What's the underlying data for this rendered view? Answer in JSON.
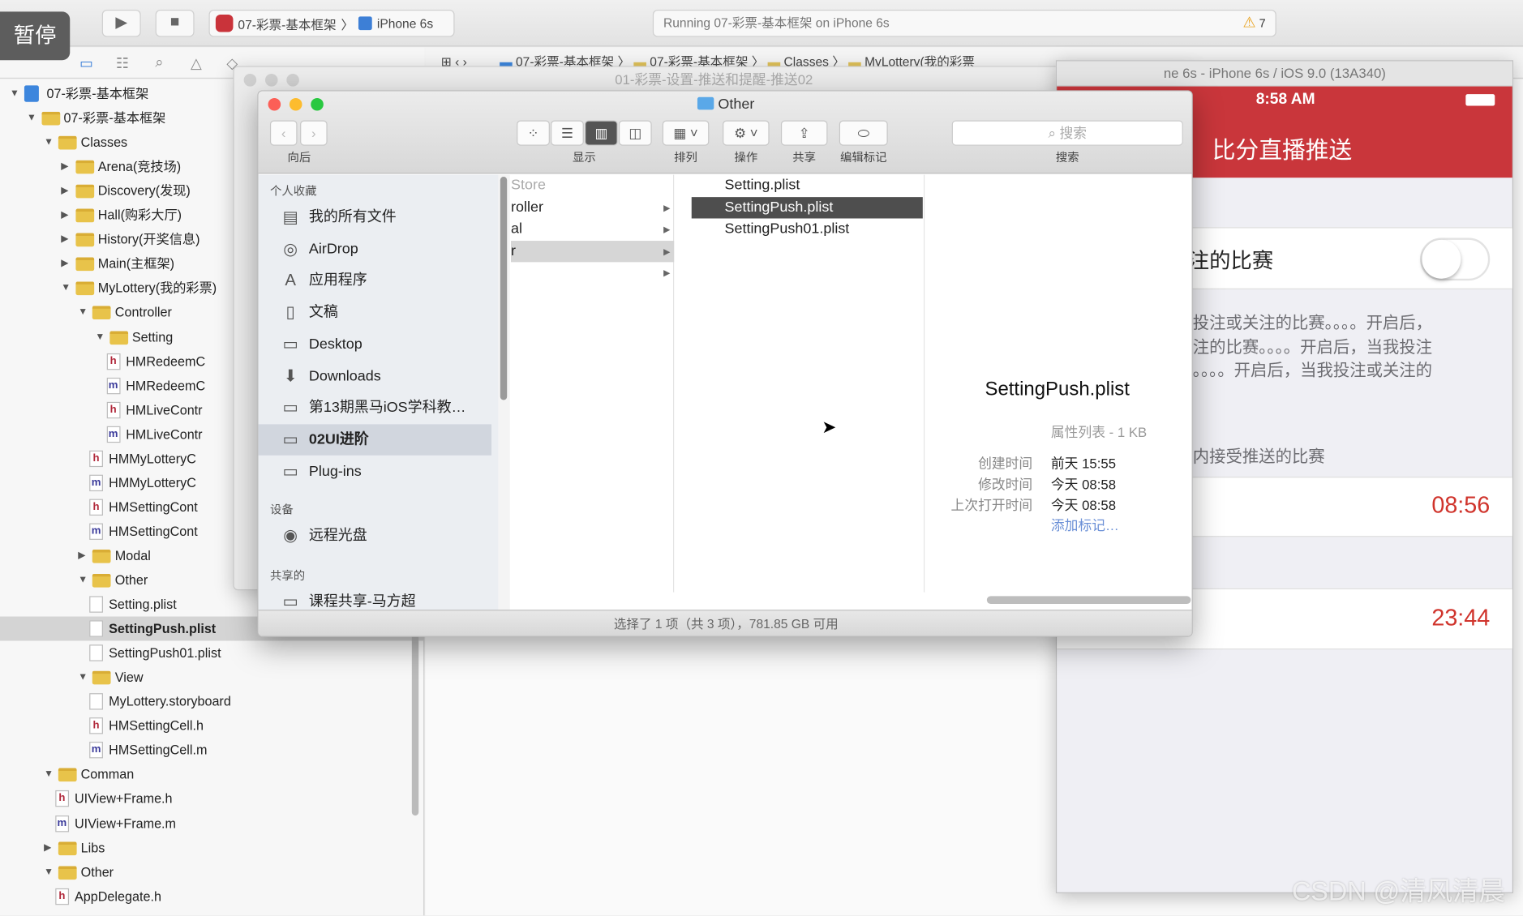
{
  "overlay": {
    "pause_label": "暂停"
  },
  "toolbar": {
    "scheme_app": "07-彩票-基本框架",
    "scheme_device": "iPhone 6s",
    "status": "Running 07-彩票-基本框架 on iPhone 6s",
    "warning_count": "7"
  },
  "jumpbar": {
    "path": [
      "07-彩票-基本框架",
      "07-彩票-基本框架",
      "Classes",
      "MyLottery(我的彩票"
    ]
  },
  "navigator": {
    "items": [
      {
        "label": "07-彩票-基本框架",
        "level": 0,
        "kind": "project",
        "open": true
      },
      {
        "label": "07-彩票-基本框架",
        "level": 1,
        "kind": "folder",
        "open": true
      },
      {
        "label": "Classes",
        "level": 2,
        "kind": "folder",
        "open": true
      },
      {
        "label": "Arena(竞技场)",
        "level": 3,
        "kind": "folder",
        "open": false
      },
      {
        "label": "Discovery(发现)",
        "level": 3,
        "kind": "folder",
        "open": false
      },
      {
        "label": "Hall(购彩大厅)",
        "level": 3,
        "kind": "folder",
        "open": false
      },
      {
        "label": "History(开奖信息)",
        "level": 3,
        "kind": "folder",
        "open": false
      },
      {
        "label": "Main(主框架)",
        "level": 3,
        "kind": "folder",
        "open": false
      },
      {
        "label": "MyLottery(我的彩票)",
        "level": 3,
        "kind": "folder",
        "open": true
      },
      {
        "label": "Controller",
        "level": 4,
        "kind": "folder",
        "open": true
      },
      {
        "label": "Setting",
        "level": 5,
        "kind": "folder",
        "open": true
      },
      {
        "label": "HMRedeemC",
        "level": 6,
        "kind": "h"
      },
      {
        "label": "HMRedeemC",
        "level": 6,
        "kind": "m"
      },
      {
        "label": "HMLiveContr",
        "level": 6,
        "kind": "h"
      },
      {
        "label": "HMLiveContr",
        "level": 6,
        "kind": "m"
      },
      {
        "label": "HMMyLotteryC",
        "level": 5,
        "kind": "h"
      },
      {
        "label": "HMMyLotteryC",
        "level": 5,
        "kind": "m"
      },
      {
        "label": "HMSettingCont",
        "level": 5,
        "kind": "h"
      },
      {
        "label": "HMSettingCont",
        "level": 5,
        "kind": "m"
      },
      {
        "label": "Modal",
        "level": 4,
        "kind": "folder",
        "open": false
      },
      {
        "label": "Other",
        "level": 4,
        "kind": "folder",
        "open": true
      },
      {
        "label": "Setting.plist",
        "level": 5,
        "kind": "plist"
      },
      {
        "label": "SettingPush.plist",
        "level": 5,
        "kind": "plist",
        "selected": true
      },
      {
        "label": "SettingPush01.plist",
        "level": 5,
        "kind": "plist"
      },
      {
        "label": "View",
        "level": 4,
        "kind": "folder",
        "open": true
      },
      {
        "label": "MyLottery.storyboard",
        "level": 5,
        "kind": "plist"
      },
      {
        "label": "HMSettingCell.h",
        "level": 5,
        "kind": "h"
      },
      {
        "label": "HMSettingCell.m",
        "level": 5,
        "kind": "m"
      },
      {
        "label": "Comman",
        "level": 2,
        "kind": "folder",
        "open": true
      },
      {
        "label": "UIView+Frame.h",
        "level": 3,
        "kind": "h"
      },
      {
        "label": "UIView+Frame.m",
        "level": 3,
        "kind": "m"
      },
      {
        "label": "Libs",
        "level": 2,
        "kind": "folder",
        "open": false
      },
      {
        "label": "Other",
        "level": 2,
        "kind": "folder",
        "open": true
      },
      {
        "label": "AppDelegate.h",
        "level": 3,
        "kind": "h"
      }
    ]
  },
  "back_window": {
    "title": "01-彩票-设置-推送和提醒-推送02"
  },
  "finder": {
    "title": "Other",
    "toolbar": {
      "back_forward": "向后",
      "view": "显示",
      "arrange": "排列",
      "action": "操作",
      "share": "共享",
      "tags": "编辑标记",
      "search_label": "搜索",
      "search_placeholder": "搜索"
    },
    "sidebar": {
      "favorites_header": "个人收藏",
      "favorites": [
        {
          "label": "我的所有文件",
          "icon": "all-files-icon"
        },
        {
          "label": "AirDrop",
          "icon": "airdrop-icon"
        },
        {
          "label": "应用程序",
          "icon": "applications-icon"
        },
        {
          "label": "文稿",
          "icon": "documents-icon"
        },
        {
          "label": "Desktop",
          "icon": "desktop-icon"
        },
        {
          "label": "Downloads",
          "icon": "downloads-icon"
        },
        {
          "label": "第13期黑马iOS学科教…",
          "icon": "folder-icon"
        },
        {
          "label": "02UI进阶",
          "icon": "folder-icon",
          "selected": true
        },
        {
          "label": "Plug-ins",
          "icon": "folder-icon"
        }
      ],
      "devices_header": "设备",
      "devices": [
        {
          "label": "远程光盘",
          "icon": "disc-icon"
        }
      ],
      "shared_header": "共享的",
      "shared": [
        {
          "label": "课程共享-马方超",
          "icon": "computer-icon"
        }
      ]
    },
    "column1": [
      {
        "label": "Store"
      },
      {
        "label": "roller",
        "arrow": true
      },
      {
        "label": "al",
        "arrow": true
      },
      {
        "label": "r",
        "arrow": true,
        "selected": true
      },
      {
        "label": "",
        "arrow": true
      }
    ],
    "column2": [
      {
        "label": "Setting.plist"
      },
      {
        "label": "SettingPush.plist",
        "selected": true
      },
      {
        "label": "SettingPush01.plist"
      }
    ],
    "preview": {
      "name": "SettingPush.plist",
      "kind": "属性列表 - 1 KB",
      "meta": [
        {
          "key": "创建时间",
          "value": "前天 15:55"
        },
        {
          "key": "修改时间",
          "value": "今天 08:58"
        },
        {
          "key": "上次打开时间",
          "value": "今天 08:58"
        }
      ],
      "add_tags": "添加标记…"
    },
    "status": "选择了 1 项（共 3 项），781.85 GB 可用"
  },
  "simulator": {
    "title": "ne 6s - iPhone 6s / iOS 9.0 (13A340)",
    "time": "8:58 AM",
    "nav_title": "比分直播推送",
    "switch_label": "注的比赛",
    "switch_on": false,
    "footer_lines": [
      "投注或关注的比赛。。。。开启后，",
      "注的比赛。。。。开启后，当我投注",
      "。。。。开启后，当我投注或关注的"
    ],
    "section_footer": "内接受推送的比赛",
    "start_time": "08:56",
    "end_time": "23:44",
    "accent": "#c9363b"
  },
  "watermark": "CSDN @清风清晨"
}
